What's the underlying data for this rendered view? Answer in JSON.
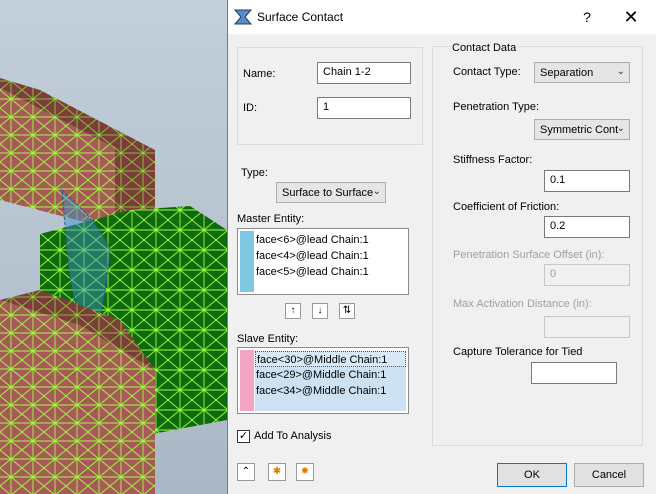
{
  "dialog": {
    "title": "Surface Contact",
    "help_label": "?",
    "close_label": "✕"
  },
  "left": {
    "name_label": "Name:",
    "name_value": "Chain 1-2",
    "id_label": "ID:",
    "id_value": "1",
    "type_label": "Type:",
    "type_value": "Surface to Surface",
    "master_label": "Master Entity:",
    "master_items": [
      "face<6>@lead Chain:1",
      "face<4>@lead Chain:1",
      "face<5>@lead Chain:1"
    ],
    "master_color": "#7ec8e3",
    "slave_label": "Slave Entity:",
    "slave_items": [
      "face<30>@Middle Chain:1",
      "face<29>@Middle Chain:1",
      "face<34>@Middle Chain:1"
    ],
    "slave_color": "#f2a6c4",
    "add_to_analysis_label": "Add To Analysis",
    "add_to_analysis_checked": true
  },
  "contact_data": {
    "group_label": "Contact Data",
    "contact_type_label": "Contact Type:",
    "contact_type_value": "Separation",
    "penetration_type_label": "Penetration Type:",
    "penetration_type_value": "Symmetric Cont",
    "stiffness_label": "Stiffness Factor:",
    "stiffness_value": "0.1",
    "friction_label": "Coefficient of Friction:",
    "friction_value": "0.2",
    "pen_offset_label": "Penetration Surface Offset (in):",
    "pen_offset_value": "0",
    "max_activation_label": "Max Activation Distance (in):",
    "max_activation_value": "",
    "capture_label": "Capture Tolerance for Tied",
    "capture_value": ""
  },
  "footer": {
    "ok_label": "OK",
    "cancel_label": "Cancel"
  },
  "colors": {
    "mesh_red": "#a85a5a",
    "mesh_green": "#0f6a0f",
    "mesh_lines": "#9aff3a",
    "selection_blue": "#3a8fd0"
  }
}
